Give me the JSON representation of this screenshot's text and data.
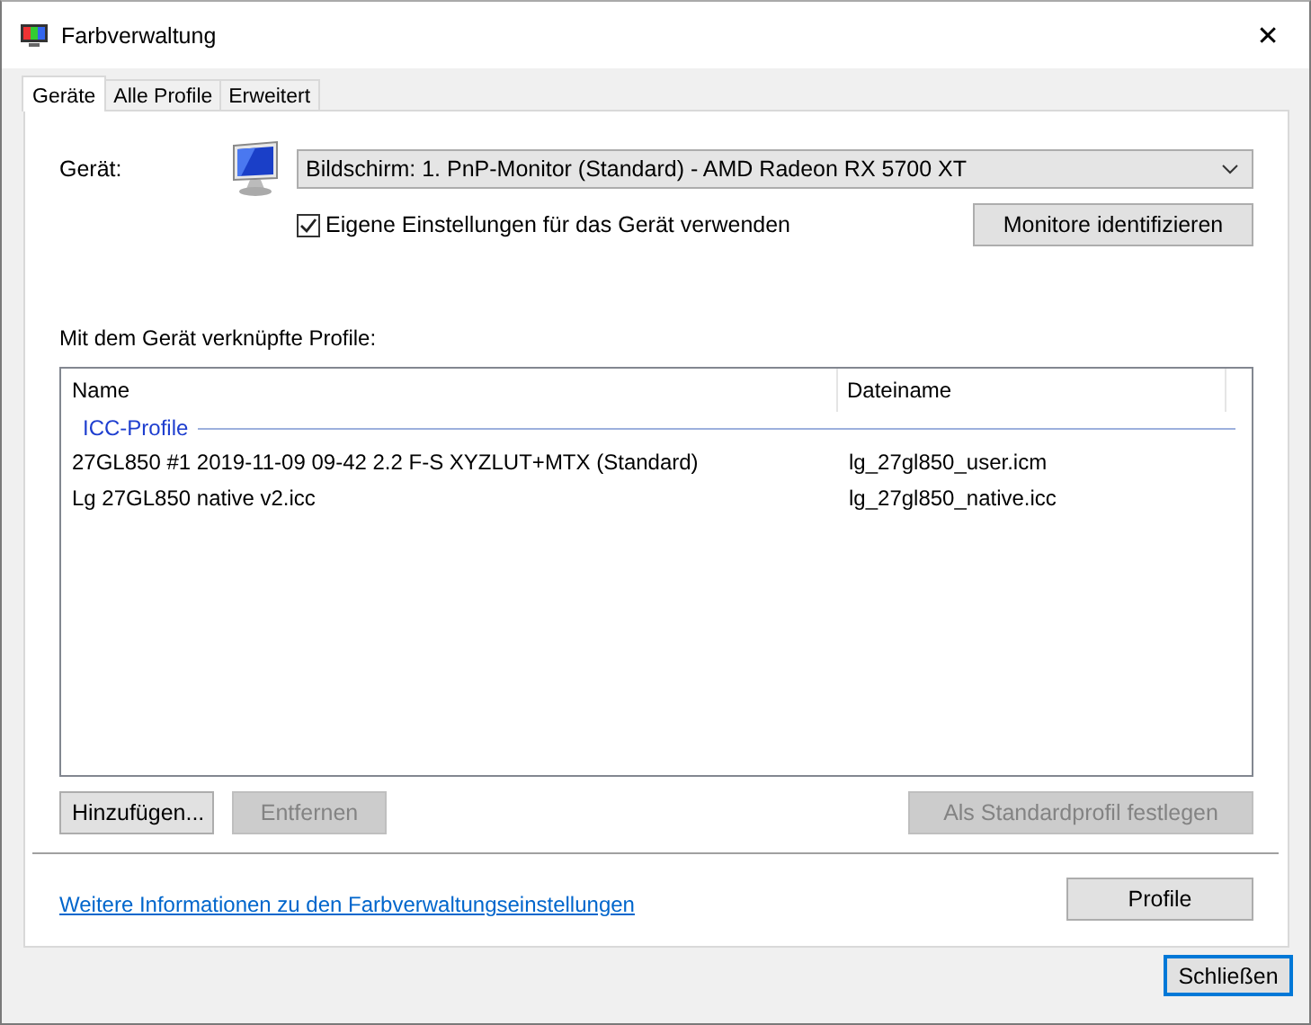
{
  "window": {
    "title": "Farbverwaltung",
    "close": "✕"
  },
  "tabs": [
    {
      "label": "Geräte",
      "selected": true
    },
    {
      "label": "Alle Profile",
      "selected": false
    },
    {
      "label": "Erweitert",
      "selected": false
    }
  ],
  "device": {
    "label": "Gerät:",
    "value": "Bildschirm: 1. PnP-Monitor (Standard) - AMD Radeon RX 5700 XT"
  },
  "own_settings": {
    "label": "Eigene Einstellungen für das Gerät verwenden",
    "checked": true
  },
  "identify_button": {
    "label": "Monitore identifizieren",
    "disabled": false
  },
  "profiles_heading": "Mit dem Gerät verknüpfte Profile:",
  "table": {
    "columns": [
      "Name",
      "Dateiname"
    ],
    "groups": [
      {
        "label": "ICC-Profile",
        "rows": [
          {
            "name": "27GL850 #1 2019-11-09 09-42 2.2 F-S XYZLUT+MTX (Standard)",
            "file": "lg_27gl850_user.icm"
          },
          {
            "name": "Lg 27GL850 native v2.icc",
            "file": "lg_27gl850_native.icc"
          }
        ]
      }
    ]
  },
  "list_buttons": [
    {
      "label": "Hinzufügen...",
      "disabled": false
    },
    {
      "label": "Entfernen",
      "disabled": true
    },
    {
      "label": "Als Standardprofil festlegen",
      "disabled": true
    }
  ],
  "info_link": "Weitere Informationen zu den Farbverwaltungseinstellungen",
  "profile_button": {
    "label": "Profile",
    "disabled": false
  },
  "close_button": {
    "label": "Schließen",
    "disabled": false
  }
}
